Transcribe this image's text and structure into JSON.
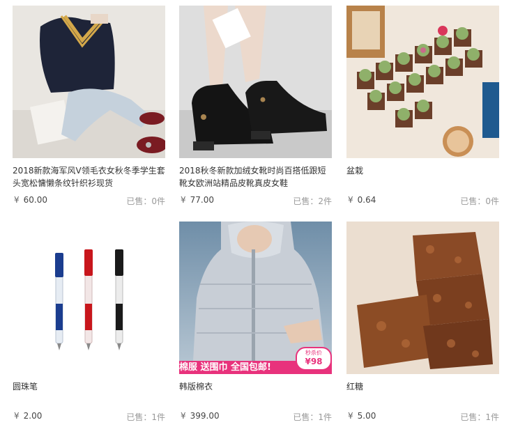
{
  "products": [
    {
      "title": "2018新款海军风V领毛衣女秋冬季学生套头宽松慵懒条纹针织衫现货",
      "currency": "¥",
      "price": "60.00",
      "sold_label": "已售：",
      "sold_count": "0件",
      "image": "sweater-photo"
    },
    {
      "title": "2018秋冬新款加绒女靴时尚百搭低跟短靴女欧洲站精品皮靴真皮女鞋",
      "currency": "¥",
      "price": "77.00",
      "sold_label": "已售：",
      "sold_count": "2件",
      "image": "boots-photo"
    },
    {
      "title": "盆栽",
      "currency": "¥",
      "price": "0.64",
      "sold_label": "已售：",
      "sold_count": "0件",
      "image": "succulents-photo"
    },
    {
      "title": "圆珠笔",
      "currency": "¥",
      "price": "2.00",
      "sold_label": "已售：",
      "sold_count": "1件",
      "image": "pens-photo"
    },
    {
      "title": "韩版棉衣",
      "currency": "¥",
      "price": "399.00",
      "sold_label": "已售：",
      "sold_count": "1件",
      "image": "jacket-photo",
      "banner_text": "棉服 送围巾 全国包邮!",
      "badge_top": "秒杀价",
      "badge_price": "¥98"
    },
    {
      "title": "红糖",
      "currency": "¥",
      "price": "5.00",
      "sold_label": "已售：",
      "sold_count": "1件",
      "image": "brown-sugar-photo"
    }
  ],
  "colors": {
    "title": "#333333",
    "sold": "#999999",
    "badge": "#e8327c"
  }
}
